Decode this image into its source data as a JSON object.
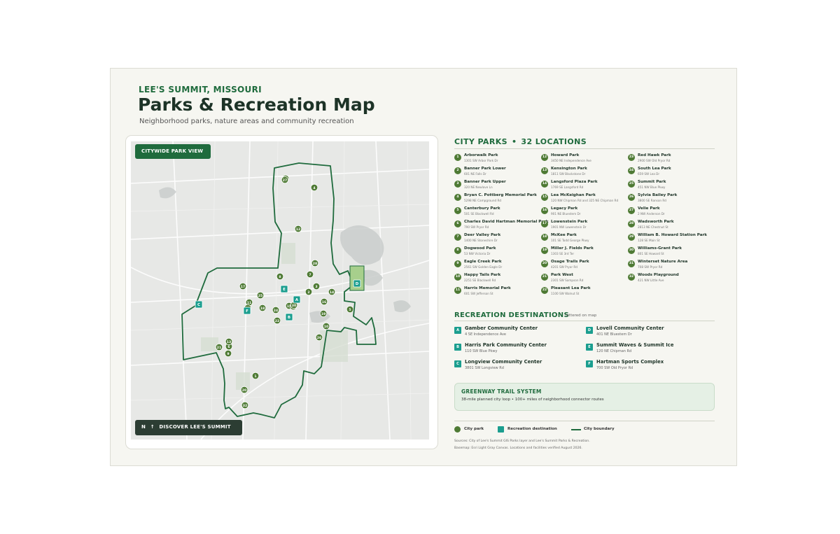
{
  "header": {
    "eyebrow": "LEE'S SUMMIT, MISSOURI",
    "title": "Parks & Recreation Map",
    "subtitle": "Neighborhood parks, nature areas and community recreation"
  },
  "map": {
    "view_label": "CITYWIDE PARK VIEW",
    "discover_label": "DISCOVER LEE'S SUMMIT",
    "north_letter": "N",
    "north_arrow": "↑",
    "colors": {
      "park": "#4e7a34",
      "recreation": "#1b9e8f",
      "boundary": "#1f6b3d",
      "water": "#c9cdcb",
      "land": "#e7e8e6"
    },
    "park_markers": [
      "1",
      "2",
      "3",
      "4",
      "5",
      "6",
      "7",
      "8",
      "9",
      "10",
      "11",
      "12",
      "13",
      "14",
      "15",
      "16",
      "17",
      "18",
      "19",
      "20",
      "21",
      "22",
      "23",
      "24",
      "25",
      "26",
      "27",
      "28",
      "29",
      "30",
      "31",
      "32"
    ],
    "recreation_markers": [
      "A",
      "B",
      "C",
      "D",
      "E",
      "F"
    ]
  },
  "parks": {
    "heading": "CITY PARKS",
    "separator": "•",
    "count": "32 LOCATIONS",
    "items": [
      {
        "num": "1",
        "name": "Arborwalk Park",
        "addr": "1301 SW Arbor Park Dr"
      },
      {
        "num": "2",
        "name": "Banner Park Lower",
        "addr": "601 NE Falls Dr"
      },
      {
        "num": "3",
        "name": "Banner Park Upper",
        "addr": "320 NE Newlove Ln"
      },
      {
        "num": "4",
        "name": "Bryan C. Pottberg Memorial Park",
        "addr": "5298 NE Campground Rd"
      },
      {
        "num": "5",
        "name": "Canterbury Park",
        "addr": "501 SE Blackwell Rd"
      },
      {
        "num": "6",
        "name": "Charles David Hartman Memorial Park",
        "addr": "790 SW Pryor Rd"
      },
      {
        "num": "7",
        "name": "Deer Valley Park",
        "addr": "1400 NE Stoneshire Dr"
      },
      {
        "num": "8",
        "name": "Dogwood Park",
        "addr": "53 NW Victoria Dr"
      },
      {
        "num": "9",
        "name": "Eagle Creek Park",
        "addr": "2561 SW Golden Eagle Dr"
      },
      {
        "num": "10",
        "name": "Happy Tails Park",
        "addr": "2251 SE Blackwell Rd"
      },
      {
        "num": "11",
        "name": "Harris Memorial Park",
        "addr": "601 SW Jefferson St"
      },
      {
        "num": "12",
        "name": "Howard Park",
        "addr": "3450 NE Independence Ave"
      },
      {
        "num": "13",
        "name": "Kensington Park",
        "addr": "1811 SW Blackstone Dr"
      },
      {
        "num": "14",
        "name": "Langsford Plaza Park",
        "addr": "1769 SE Langsford Rd"
      },
      {
        "num": "15",
        "name": "Lea McKeighan Park",
        "addr": "120 NW Chipman Rd and 325 NE Chipman Rd"
      },
      {
        "num": "16",
        "name": "Legacy Park",
        "addr": "901 NE Bluestem Dr"
      },
      {
        "num": "17",
        "name": "Lowenstein Park",
        "addr": "1901 NW Lowenstein Dr"
      },
      {
        "num": "18",
        "name": "McKee Park",
        "addr": "101 SE Todd George Pkwy"
      },
      {
        "num": "19",
        "name": "Miller J. Fields Park",
        "addr": "1303 SE 3rd Ter"
      },
      {
        "num": "20",
        "name": "Osage Trails Park",
        "addr": "4201 SW Pryor Rd"
      },
      {
        "num": "21",
        "name": "Park West",
        "addr": "2301 SW Sampson Rd"
      },
      {
        "num": "22",
        "name": "Pleasant Lea Park",
        "addr": "1100 SW Walnut St"
      },
      {
        "num": "23",
        "name": "Red Hawk Park",
        "addr": "2900 SW Old Pryor Rd"
      },
      {
        "num": "24",
        "name": "South Lea Park",
        "addr": "659 SW Lea Dr"
      },
      {
        "num": "25",
        "name": "Summit Park",
        "addr": "451 NW Blue Pkwy"
      },
      {
        "num": "26",
        "name": "Sylvia Bailey Park",
        "addr": "3800 SE Ranson Rd"
      },
      {
        "num": "27",
        "name": "Velie Park",
        "addr": "2 NW Anderson Dr"
      },
      {
        "num": "28",
        "name": "Wadsworth Park",
        "addr": "2813 NE Chestnut St"
      },
      {
        "num": "29",
        "name": "William B. Howard Station Park",
        "addr": "128 SE Main St"
      },
      {
        "num": "30",
        "name": "Williams-Grant Park",
        "addr": "801 SE Howard St"
      },
      {
        "num": "31",
        "name": "Winterset Nature Area",
        "addr": "708 SW Pryor Rd"
      },
      {
        "num": "32",
        "name": "Woods Playground",
        "addr": "421 NW Little Ave"
      }
    ]
  },
  "recreation": {
    "heading": "RECREATION DESTINATIONS",
    "note": "lettered on map",
    "items": [
      {
        "letter": "A",
        "name": "Gamber Community Center",
        "addr": "4 SE Independence Ave"
      },
      {
        "letter": "B",
        "name": "Harris Park Community Center",
        "addr": "110 SW Blue Pkwy"
      },
      {
        "letter": "C",
        "name": "Longview Community Center",
        "addr": "3801 SW Longview Rd"
      },
      {
        "letter": "D",
        "name": "Lovell Community Center",
        "addr": "401 NE Bluestem Dr"
      },
      {
        "letter": "E",
        "name": "Summit Waves & Summit Ice",
        "addr": "120 NE Chipman Rd"
      },
      {
        "letter": "F",
        "name": "Hartman Sports Complex",
        "addr": "700 SW Old Pryor Rd"
      }
    ]
  },
  "greenway": {
    "title": "GREENWAY TRAIL SYSTEM",
    "text": "38-mile planned city loop • 100+ miles of neighborhood connector routes"
  },
  "legend": {
    "park": "City park",
    "recreation": "Recreation destination",
    "boundary": "City boundary"
  },
  "sources": {
    "line1": "Sources: City of Lee's Summit GIS Parks layer and Lee's Summit Parks & Recreation.",
    "line2": "Basemap: Esri Light Gray Canvas. Locations and facilities verified August 2026."
  }
}
